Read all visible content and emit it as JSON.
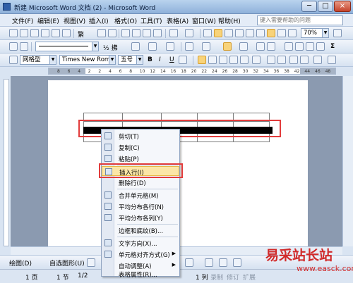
{
  "window": {
    "title": "新建 Microsoft Word 文档 (2) - Microsoft Word",
    "minimize": "─",
    "maximize": "□",
    "close": "×"
  },
  "menubar": {
    "items": [
      "文件(F)",
      "编辑(E)",
      "视图(V)",
      "插入(I)",
      "格式(O)",
      "工具(T)",
      "表格(A)",
      "窗口(W)",
      "帮助(H)"
    ],
    "help_placeholder": "键入需要帮助的问题"
  },
  "toolbar_standard": {
    "zoom": "70%",
    "mode": "繁",
    "ab_label": "½ 拂"
  },
  "toolbar_format": {
    "style": "网格型",
    "font": "Times New Roma",
    "size": "五号",
    "bold": "B",
    "italic": "I",
    "underline": "U",
    "sigma": "Σ"
  },
  "ruler": {
    "labels": [
      "8",
      "6",
      "4",
      "2",
      "2",
      "4",
      "6",
      "8",
      "10",
      "12",
      "14",
      "16",
      "18",
      "20",
      "22",
      "24",
      "26",
      "28",
      "30",
      "32",
      "34",
      "36",
      "38",
      "42",
      "44",
      "46",
      "48"
    ]
  },
  "context_menu": {
    "items": [
      {
        "label": "剪切(T)",
        "icon": "scissors-icon"
      },
      {
        "label": "复制(C)",
        "icon": "copy-icon"
      },
      {
        "label": "粘贴(P)",
        "icon": "paste-icon"
      },
      {
        "label": "插入行(I)",
        "icon": "insert-row-icon",
        "highlighted": true
      },
      {
        "label": "删除行(D)",
        "icon": ""
      },
      {
        "label": "合并单元格(M)",
        "icon": "merge-cells-icon"
      },
      {
        "label": "平均分布各行(N)",
        "icon": "distribute-rows-icon"
      },
      {
        "label": "平均分布各列(Y)",
        "icon": "distribute-columns-icon"
      },
      {
        "label": "边框和底纹(B)...",
        "icon": ""
      },
      {
        "label": "文字方向(X)...",
        "icon": "text-direction-icon"
      },
      {
        "label": "单元格对齐方式(G)",
        "icon": "cell-align-icon",
        "submenu": true
      },
      {
        "label": "自动调整(A)",
        "icon": "",
        "submenu": true
      },
      {
        "label": "表格属性(R)...",
        "icon": ""
      }
    ]
  },
  "drawbar": {
    "draw": "绘图(D)",
    "autoshape": "自选图形(U)"
  },
  "statusbar": {
    "page": "1 页",
    "section": "1 节",
    "pages": "1/2",
    "col": "1 列",
    "rec": "录制",
    "trk": "修订",
    "ext": "扩展"
  },
  "watermark": {
    "text": "易采站长站",
    "url": "www.easck.com"
  }
}
